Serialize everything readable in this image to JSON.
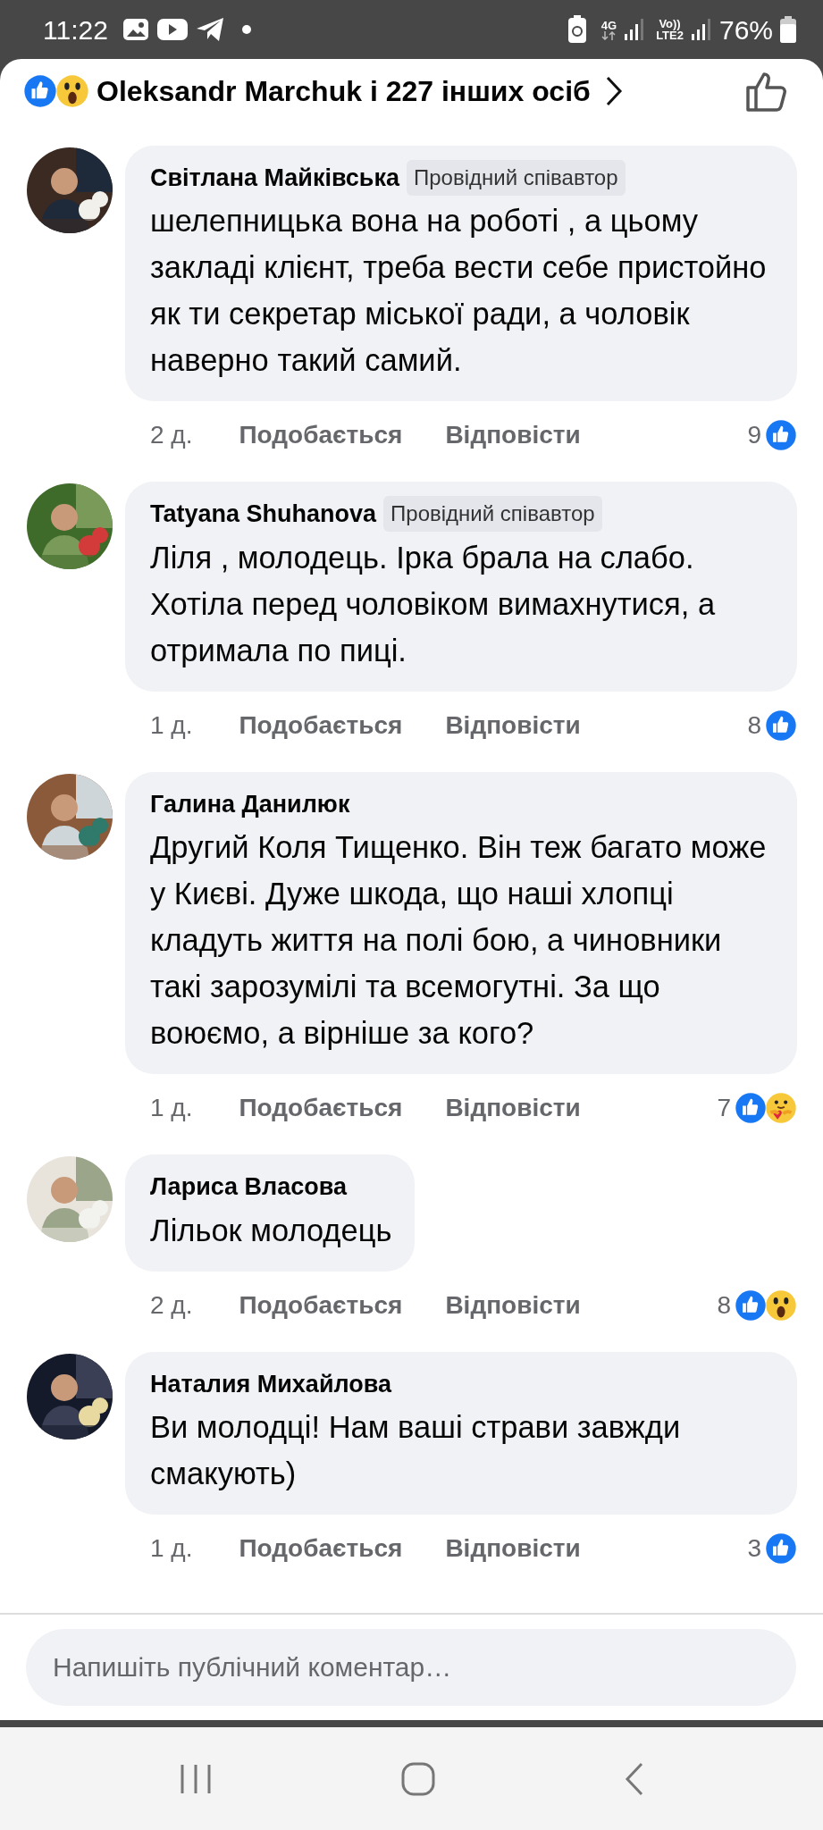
{
  "status_bar": {
    "time": "11:22",
    "network": "4G",
    "volte": "Vo))",
    "lte": "LTE2",
    "battery": "76%"
  },
  "header": {
    "reactions": [
      {
        "kind": "like"
      },
      {
        "kind": "wow"
      }
    ],
    "text": "Oleksandr Marchuk і 227 інших осіб"
  },
  "comments": [
    {
      "author": "Світлана Майківська",
      "badge": "Провідний співавтор",
      "text": "шелепницька вона на роботі , а цьому закладі клієнт, треба вести себе пристойно як ти секретар міської ради, а чоловік наверно такий самий.",
      "time": "2 д.",
      "like_label": "Подобається",
      "reply_label": "Відповісти",
      "count": "9",
      "reactions": [
        {
          "kind": "like"
        }
      ]
    },
    {
      "author": "Tatyana  Shuhanova",
      "badge": "Провідний співавтор",
      "text": "Ліля , молодець. Ірка брала на слабо. Хотіла перед чоловіком вимахнутися, а отримала по пиці.",
      "time": "1 д.",
      "like_label": "Подобається",
      "reply_label": "Відповісти",
      "count": "8",
      "reactions": [
        {
          "kind": "like"
        }
      ]
    },
    {
      "author": "Галина Данилюк",
      "text": "Другий Коля Тищенко. Він теж багато може у Києві. Дуже шкода, що наші хлопці кладуть життя на полі бою, а чиновники такі зарозумілі та всемогутні. За що воюємо, а вірніше за кого?",
      "time": "1 д.",
      "like_label": "Подобається",
      "reply_label": "Відповісти",
      "count": "7",
      "reactions": [
        {
          "kind": "like"
        },
        {
          "kind": "care"
        }
      ]
    },
    {
      "author": "Лариса Власова",
      "text": "Лільок молодець",
      "time": "2 д.",
      "like_label": "Подобається",
      "reply_label": "Відповісти",
      "count": "8",
      "reactions": [
        {
          "kind": "like"
        },
        {
          "kind": "wow"
        }
      ]
    },
    {
      "author": "Наталия Михайлова",
      "text": "Ви молодці! Нам ваші страви завжди смакують)",
      "time": "1 д.",
      "like_label": "Подобається",
      "reply_label": "Відповісти",
      "count": "3",
      "reactions": [
        {
          "kind": "like"
        }
      ]
    }
  ],
  "composer": {
    "placeholder": "Напишіть публічний коментар…"
  }
}
